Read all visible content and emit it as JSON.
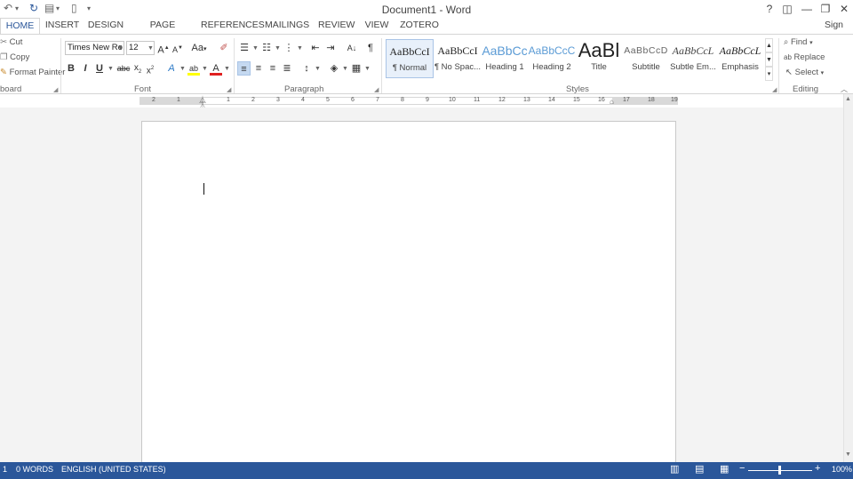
{
  "window": {
    "title": "Document1 - Word",
    "help": "?",
    "sign_in": "Sign in"
  },
  "quick_access": {
    "undo_icon": "↶",
    "redo_icon": "↻",
    "customize_icon": "▾"
  },
  "tabs": [
    {
      "label": "HOME"
    },
    {
      "label": "INSERT"
    },
    {
      "label": "DESIGN"
    },
    {
      "label": "PAGE LAYOUT"
    },
    {
      "label": "REFERENCES"
    },
    {
      "label": "MAILINGS"
    },
    {
      "label": "REVIEW"
    },
    {
      "label": "VIEW"
    },
    {
      "label": "ZOTERO"
    }
  ],
  "clipboard": {
    "cut": "Cut",
    "copy": "Copy",
    "format_painter": "Format Painter",
    "group_label": "board"
  },
  "font": {
    "name": "Times New Ro",
    "size": "12",
    "group_label": "Font",
    "grow": "A",
    "shrink": "A",
    "change_case": "Aa",
    "bold": "B",
    "italic": "I",
    "underline": "U",
    "strike": "abc",
    "subscript": "x",
    "superscript": "x",
    "effects": "A",
    "color_a": "A"
  },
  "paragraph": {
    "group_label": "Paragraph",
    "pilcrow": "¶",
    "sort": "A↓"
  },
  "styles": {
    "group_label": "Styles",
    "items": [
      {
        "preview": "AaBbCcI",
        "label": "¶ Normal"
      },
      {
        "preview": "AaBbCcI",
        "label": "¶ No Spac..."
      },
      {
        "preview": "AaBbCc",
        "label": "Heading 1"
      },
      {
        "preview": "AaBbCcC",
        "label": "Heading 2"
      },
      {
        "preview": "AaBl",
        "label": "Title"
      },
      {
        "preview": "AaBbCcD",
        "label": "Subtitle"
      },
      {
        "preview": "AaBbCcL",
        "label": "Subtle Em..."
      },
      {
        "preview": "AaBbCcL",
        "label": "Emphasis"
      }
    ]
  },
  "editing": {
    "group_label": "Editing",
    "find": "Find",
    "replace": "Replace",
    "select": "Select"
  },
  "ruler": {
    "left_numbers": [
      "2",
      "1"
    ],
    "numbers": [
      "1",
      "2",
      "3",
      "4",
      "5",
      "6",
      "7",
      "8",
      "9",
      "10",
      "11",
      "12",
      "13",
      "14",
      "15",
      "16",
      "17",
      "18",
      "19"
    ]
  },
  "status": {
    "page": "1",
    "words": "0 WORDS",
    "language": "ENGLISH (UNITED STATES)",
    "zoom": "100%",
    "zoom_minus": "−",
    "zoom_plus": "+"
  },
  "colors": {
    "accent": "#2b579a",
    "highlight": "#ffff00",
    "font_color": "#e02020"
  }
}
